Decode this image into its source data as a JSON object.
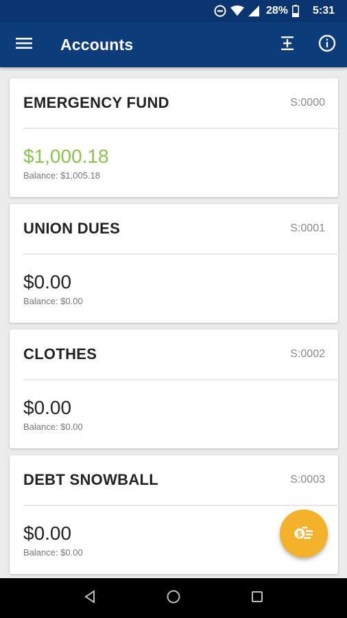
{
  "status_bar": {
    "battery_percent": "28%",
    "time": "5:31",
    "icons": [
      "do-not-disturb-icon",
      "wifi-icon",
      "cell-signal-icon",
      "battery-icon"
    ]
  },
  "app_bar": {
    "title": "Accounts",
    "menu_icon": "menu-icon",
    "actions": [
      "adjust-icon",
      "info-icon"
    ]
  },
  "accounts": [
    {
      "name": "EMERGENCY FUND",
      "code": "S:0000",
      "available": "$1,000.18",
      "balance": "Balance: $1,005.18",
      "positive": true
    },
    {
      "name": "UNION DUES",
      "code": "S:0001",
      "available": "$0.00",
      "balance": "Balance: $0.00",
      "positive": false
    },
    {
      "name": "CLOTHES",
      "code": "S:0002",
      "available": "$0.00",
      "balance": "Balance: $0.00",
      "positive": false
    },
    {
      "name": "DEBT SNOWBALL",
      "code": "S:0003",
      "available": "$0.00",
      "balance": "Balance: $0.00",
      "positive": false
    }
  ],
  "fab": {
    "icon": "transfer-money-icon"
  },
  "nav_bar": {
    "icons": [
      "back-icon",
      "home-icon",
      "recents-icon"
    ]
  },
  "colors": {
    "app_bar": "#0d3c7b",
    "status_bar": "#0b3570",
    "positive_amount": "#8bc34a",
    "fab": "#f3b22a"
  }
}
